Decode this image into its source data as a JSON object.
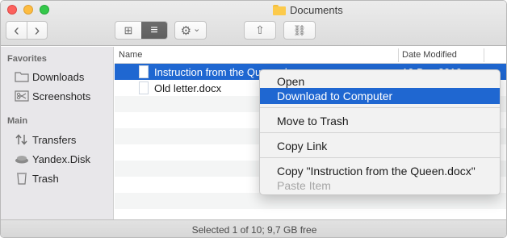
{
  "window": {
    "title": "Documents"
  },
  "toolbar": {
    "back_glyph": "‹",
    "forward_glyph": "›",
    "icon_view_glyph": "⊞",
    "list_view_glyph": "≡",
    "action_glyph": "⚙",
    "action_chevron": "⌄",
    "share_glyph": "⇧",
    "link_glyph": "⛓"
  },
  "sidebar": {
    "favorites_header": "Favorites",
    "favorites": [
      {
        "label": "Downloads",
        "icon": "folder-icon"
      },
      {
        "label": "Screenshots",
        "icon": "scissors-icon"
      }
    ],
    "main_header": "Main",
    "main": [
      {
        "label": "Transfers",
        "icon": "transfer-arrows-icon"
      },
      {
        "label": "Yandex.Disk",
        "icon": "cloud-disk-icon"
      },
      {
        "label": "Trash",
        "icon": "trash-icon"
      }
    ]
  },
  "list": {
    "columns": {
      "name": "Name",
      "date": "Date Modified"
    },
    "files": [
      {
        "name": "Instruction from the Queen.docx",
        "selected": true,
        "date": "10 Dec 2016 ..."
      },
      {
        "name": "Old letter.docx",
        "selected": false,
        "date": ""
      }
    ]
  },
  "context_menu": {
    "items": [
      {
        "label": "Open"
      },
      {
        "label": "Download to Computer",
        "highlighted": true
      },
      {
        "label": "Move to Trash"
      },
      {
        "label": "Copy Link"
      },
      {
        "label": "Copy \"Instruction from the Queen.docx\""
      },
      {
        "label": "Paste Item",
        "disabled": true
      }
    ]
  },
  "status": {
    "text": "Selected 1 of 10; 9,7 GB free"
  },
  "colors": {
    "selection": "#1f67d1",
    "sidebar": "#e8e7ea",
    "folder": "#fcca4b"
  }
}
